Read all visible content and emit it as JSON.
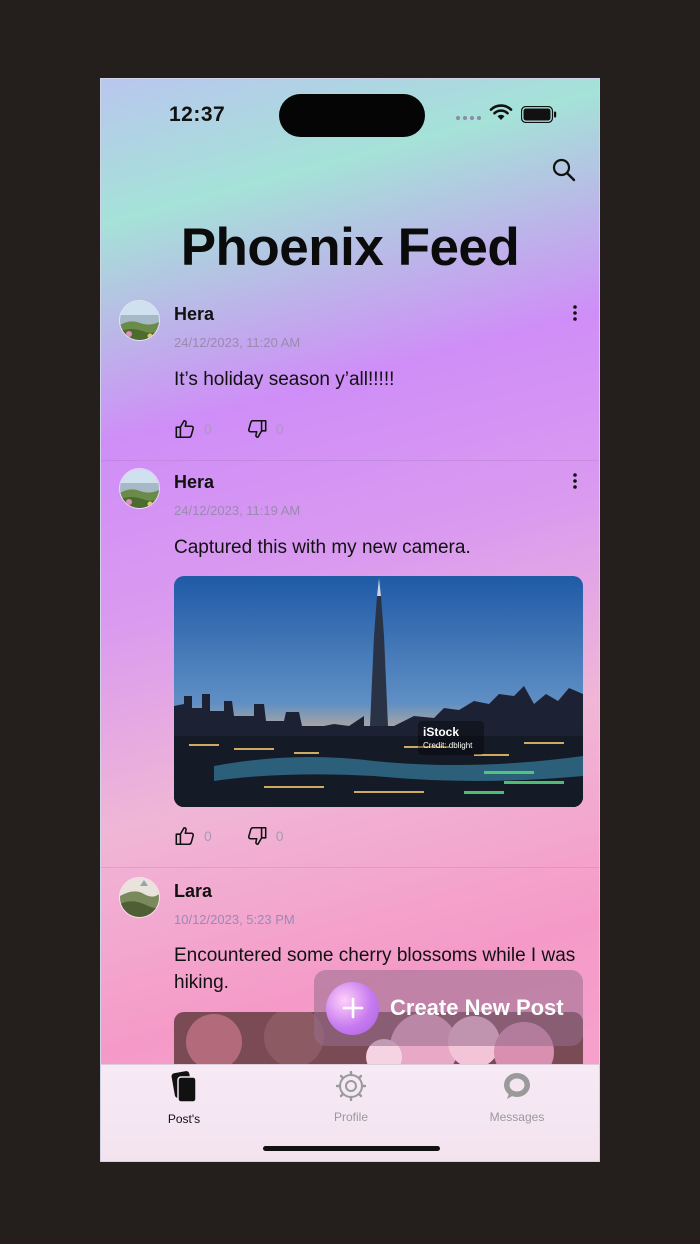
{
  "status_bar": {
    "time": "12:37"
  },
  "header": {
    "title": "Phoenix Feed",
    "search_icon": "search-icon"
  },
  "posts": [
    {
      "author": "Hera",
      "timestamp": "24/12/2023, 11:20 AM",
      "text": "It’s holiday season y’all!!!!!",
      "likes": "0",
      "dislikes": "0"
    },
    {
      "author": "Hera",
      "timestamp": "24/12/2023, 11:19 AM",
      "text": "Captured this with my new camera.",
      "image_watermark": "iStock",
      "image_credit": "Credit: dblight",
      "likes": "0",
      "dislikes": "0"
    },
    {
      "author": "Lara",
      "timestamp": "10/12/2023, 5:23 PM",
      "text": "Encountered some cherry blossoms while I was hiking."
    }
  ],
  "fab": {
    "label": "Create New Post"
  },
  "tab_bar": {
    "tabs": [
      {
        "label": "Post's",
        "icon": "posts-icon",
        "active": true
      },
      {
        "label": "Profile",
        "icon": "profile-gear-icon",
        "active": false
      },
      {
        "label": "Messages",
        "icon": "messages-icon",
        "active": false
      }
    ]
  },
  "colors": {
    "accent": "#c77bf0",
    "text": "#111111",
    "muted": "#9a8ab0"
  }
}
